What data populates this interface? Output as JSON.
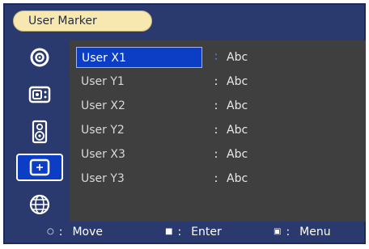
{
  "window": {
    "title": "User Marker"
  },
  "sidebar": {
    "items": [
      {
        "icon": "target-icon",
        "selected": false
      },
      {
        "icon": "display-input-icon",
        "selected": false
      },
      {
        "icon": "speaker-icon",
        "selected": false
      },
      {
        "icon": "marker-crosshair-icon",
        "selected": true
      },
      {
        "icon": "globe-icon",
        "selected": false
      }
    ]
  },
  "menu": {
    "rows": [
      {
        "label": "User X1",
        "colon": "∶",
        "value": "Abc",
        "selected": true
      },
      {
        "label": "User Y1",
        "colon": ":",
        "value": "Abc",
        "selected": false
      },
      {
        "label": "User X2",
        "colon": ":",
        "value": "Abc",
        "selected": false
      },
      {
        "label": "User Y2",
        "colon": ":",
        "value": "Abc",
        "selected": false
      },
      {
        "label": "User X3",
        "colon": ":",
        "value": "Abc",
        "selected": false
      },
      {
        "label": "User Y3",
        "colon": ":",
        "value": "Abc",
        "selected": false
      }
    ]
  },
  "footer": {
    "move": {
      "key": "○",
      "sep": ":",
      "label": "Move"
    },
    "enter": {
      "key": "■",
      "sep": ":",
      "label": "Enter"
    },
    "menu": {
      "key": "▣",
      "sep": ":",
      "label": "Menu"
    }
  },
  "colors": {
    "frame": "#2a3a6e",
    "content": "#3f3f3f",
    "selection": "#0b3ec4",
    "title_pill": "#f7e8b0"
  }
}
